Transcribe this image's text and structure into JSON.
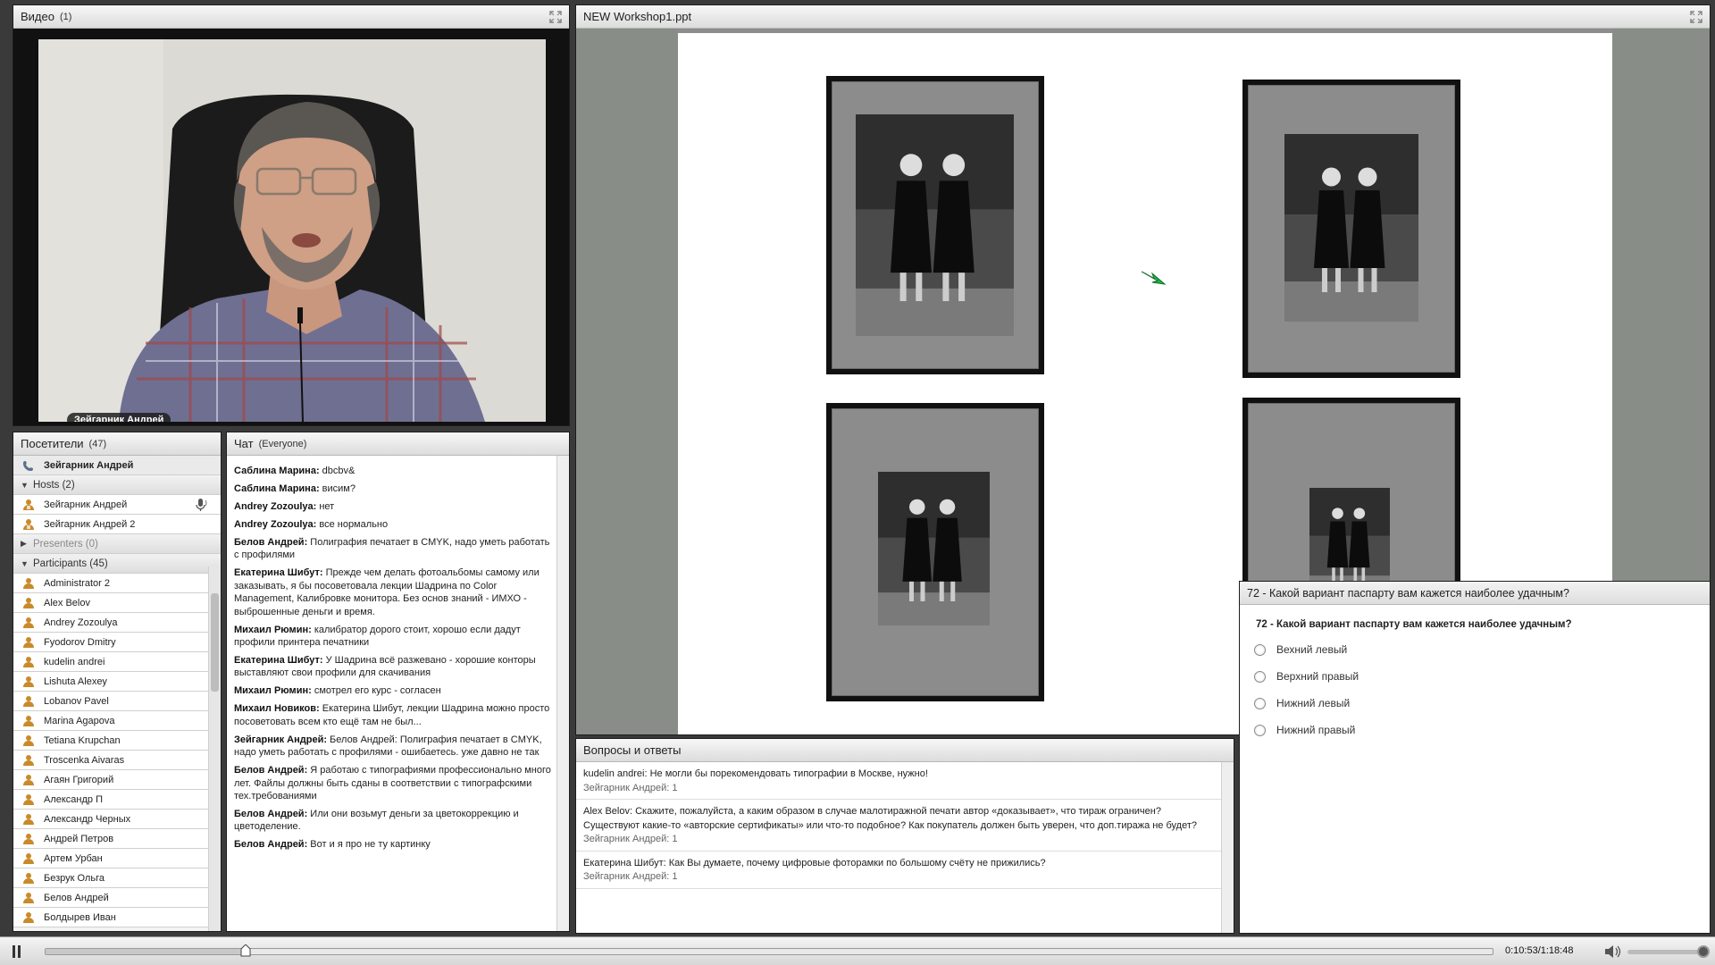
{
  "video": {
    "title": "Видео",
    "count": "(1)",
    "presenter_name": "Зейгарник Андрей"
  },
  "attendees": {
    "title": "Посетители",
    "count": "(47)",
    "speaker": "Зейгарник Андрей",
    "hosts_label": "Hosts (2)",
    "hosts": [
      "Зейгарник Андрей",
      "Зейгарник Андрей 2"
    ],
    "presenters_label": "Presenters (0)",
    "participants_label": "Participants (45)",
    "participants": [
      "Administrator 2",
      "Alex Belov",
      "Andrey Zozoulya",
      "Fyodorov Dmitry",
      "kudelin andrei",
      "Lishuta Alexey",
      "Lobanov Pavel",
      "Marina Agapova",
      "Tetiana Krupchan",
      "Troscenka Aivaras",
      "Агаян Григорий",
      "Александр П",
      "Александр Черных",
      "Андрей Петров",
      "Артем Урбан",
      "Безрук Ольга",
      "Белов Андрей",
      "Болдырев Иван"
    ]
  },
  "chat": {
    "title": "Чат",
    "scope": "(Everyone)",
    "messages": [
      {
        "author": "Саблина Марина:",
        "text": " dbcbv&"
      },
      {
        "author": "Саблина Марина:",
        "text": " висим?"
      },
      {
        "author": "Andrey Zozoulya:",
        "text": " нет"
      },
      {
        "author": "Andrey Zozoulya:",
        "text": " все нормально"
      },
      {
        "author": "Белов Андрей:",
        "text": " Полиграфия печатает в CMYK, надо уметь работать с профилями"
      },
      {
        "author": "Екатерина Шибут:",
        "text": " Прежде чем делать фотоальбомы самому или заказывать, я бы посоветовала лекции Шадрина по Color Management, Калибровке монитора. Без основ знаний - ИМХО - выброшенные деньги и время."
      },
      {
        "author": "Михаил Рюмин:",
        "text": " калибратор дорого стоит, хорошо если дадут профили принтера печатники"
      },
      {
        "author": "Екатерина Шибут:",
        "text": " У Шадрина всё разжевано - хорошие конторы выставляют свои профили для скачивания"
      },
      {
        "author": "Михаил Рюмин:",
        "text": " смотрел его курс - согласен"
      },
      {
        "author": "Михаил Новиков:",
        "text": " Екатерина Шибут, лекции Шадрина можно просто посоветовать всем кто ещё там не был..."
      },
      {
        "author": "Зейгарник Андрей:",
        "text": " Белов Андрей: Полиграфия печатает в CMYK, надо уметь работать с профилями  - ошибаетесь. уже давно не так"
      },
      {
        "author": "Белов Андрей:",
        "text": " Я работаю с типографиями профессионально много лет. Файлы должны быть сданы в соответствии с типографскими тех.требованиями"
      },
      {
        "author": "Белов Андрей:",
        "text": " Или они возьмут деньги за цветокоррекцию и цветоделение."
      },
      {
        "author": "Белов Андрей:",
        "text": " Вот и я про не ту картинку"
      }
    ]
  },
  "share": {
    "title": "NEW Workshop1.ppt"
  },
  "poll": {
    "header": "72 - Какой вариант паспарту вам кажется наиболее удачным?",
    "question": "72 - Какой вариант паспарту вам кажется наиболее удачным?",
    "options": [
      "Вехний левый",
      "Верхний правый",
      "Нижний левый",
      "Нижний правый"
    ]
  },
  "qa": {
    "title": "Вопросы и ответы",
    "items": [
      {
        "text": "kudelin andrei: Не могли бы порекомендовать типографии в Москве, нужно!",
        "by": "Зейгарник Андрей: 1"
      },
      {
        "text": "Alex Belov: Скажите, пожалуйста, а каким образом в случае малотиражной печати автор «доказывает», что тираж ограничен? Существуют какие-то «авторские сертификаты» или что-то подобное? Как покупатель должен быть уверен, что доп.тиража не будет?",
        "by": "Зейгарник Андрей: 1"
      },
      {
        "text": "Екатерина Шибут: Как Вы думаете, почему цифровые фоторамки по большому счёту не прижились?",
        "by": "Зейгарник Андрей: 1"
      }
    ]
  },
  "playback": {
    "time": "0:10:53/1:18:48",
    "progress": 0.138,
    "volume": 1.0
  }
}
